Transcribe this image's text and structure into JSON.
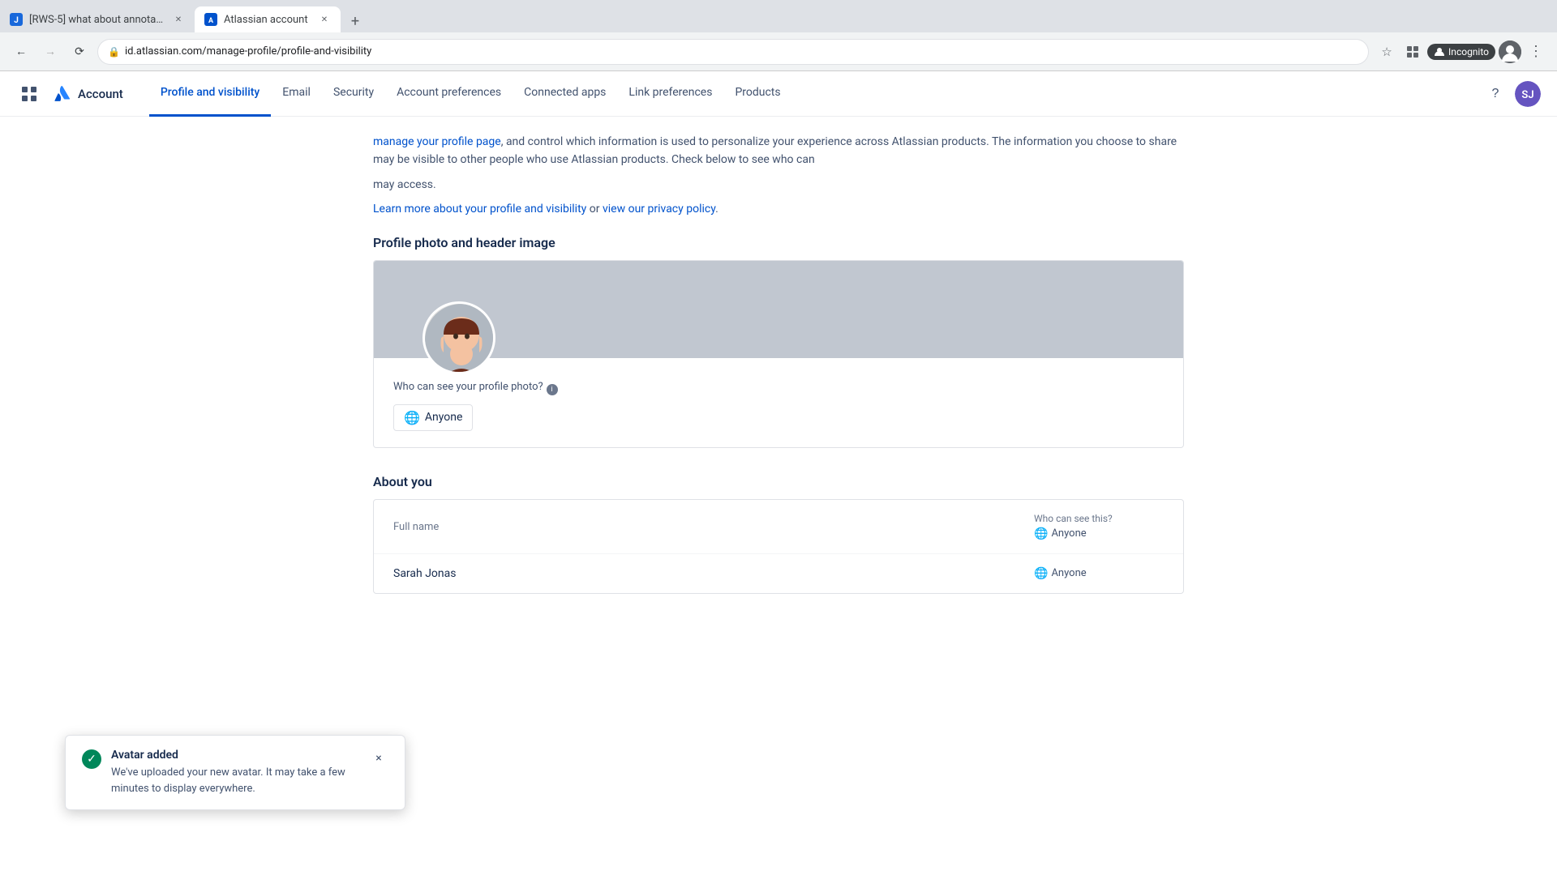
{
  "browser": {
    "tabs": [
      {
        "id": "tab-jira",
        "title": "[RWS-5] what about annotations",
        "favicon_type": "jira",
        "active": false
      },
      {
        "id": "tab-atlassian",
        "title": "Atlassian account",
        "favicon_type": "atlassian",
        "active": true
      }
    ],
    "new_tab_label": "+",
    "back_disabled": false,
    "forward_disabled": true,
    "reload_label": "⟳",
    "address": "id.atlassian.com/manage-profile/profile-and-visibility",
    "address_display": "id.atlassian.com/manage-profile/profile-and-visibility",
    "bookmark_icon": "☆",
    "extensions_icon": "⊞",
    "incognito_label": "Incognito",
    "more_label": "⋮"
  },
  "app": {
    "logo_text": "Account",
    "grid_icon": "⊞",
    "nav_links": [
      {
        "id": "profile-visibility",
        "label": "Profile and visibility",
        "active": true
      },
      {
        "id": "email",
        "label": "Email",
        "active": false
      },
      {
        "id": "security",
        "label": "Security",
        "active": false
      },
      {
        "id": "account-preferences",
        "label": "Account preferences",
        "active": false
      },
      {
        "id": "connected-apps",
        "label": "Connected apps",
        "active": false
      },
      {
        "id": "link-preferences",
        "label": "Link preferences",
        "active": false
      },
      {
        "id": "products",
        "label": "Products",
        "active": false
      }
    ],
    "help_icon": "?",
    "user_initials": "SJ"
  },
  "page": {
    "info_text_partial": "manage your profile page, and control which information is used to personalize your experience across Atlassian products. The information you choose to share may be visible to other people who use Atlassian products. Check below to see who can",
    "info_text_end": "may access.",
    "learn_more_link": "Learn more about your profile and visibility",
    "privacy_policy_link": "view our privacy policy",
    "profile_photo_section": {
      "title": "Profile photo and header image",
      "who_can_see_question": "Who can see your profile photo?",
      "audience_label": "Anyone"
    },
    "about_section": {
      "title": "About you",
      "fields": [
        {
          "label": "Full name",
          "value": "",
          "who_can_see_label": "Who can see this?",
          "audience": "Anyone"
        },
        {
          "label": "",
          "value": "Sarah Jonas",
          "who_can_see_label": "",
          "audience": "Anyone"
        }
      ]
    }
  },
  "toast": {
    "title": "Avatar added",
    "message": "We've uploaded your new avatar. It may take a few minutes to display everywhere.",
    "close_label": "×",
    "success_icon": "✓"
  }
}
